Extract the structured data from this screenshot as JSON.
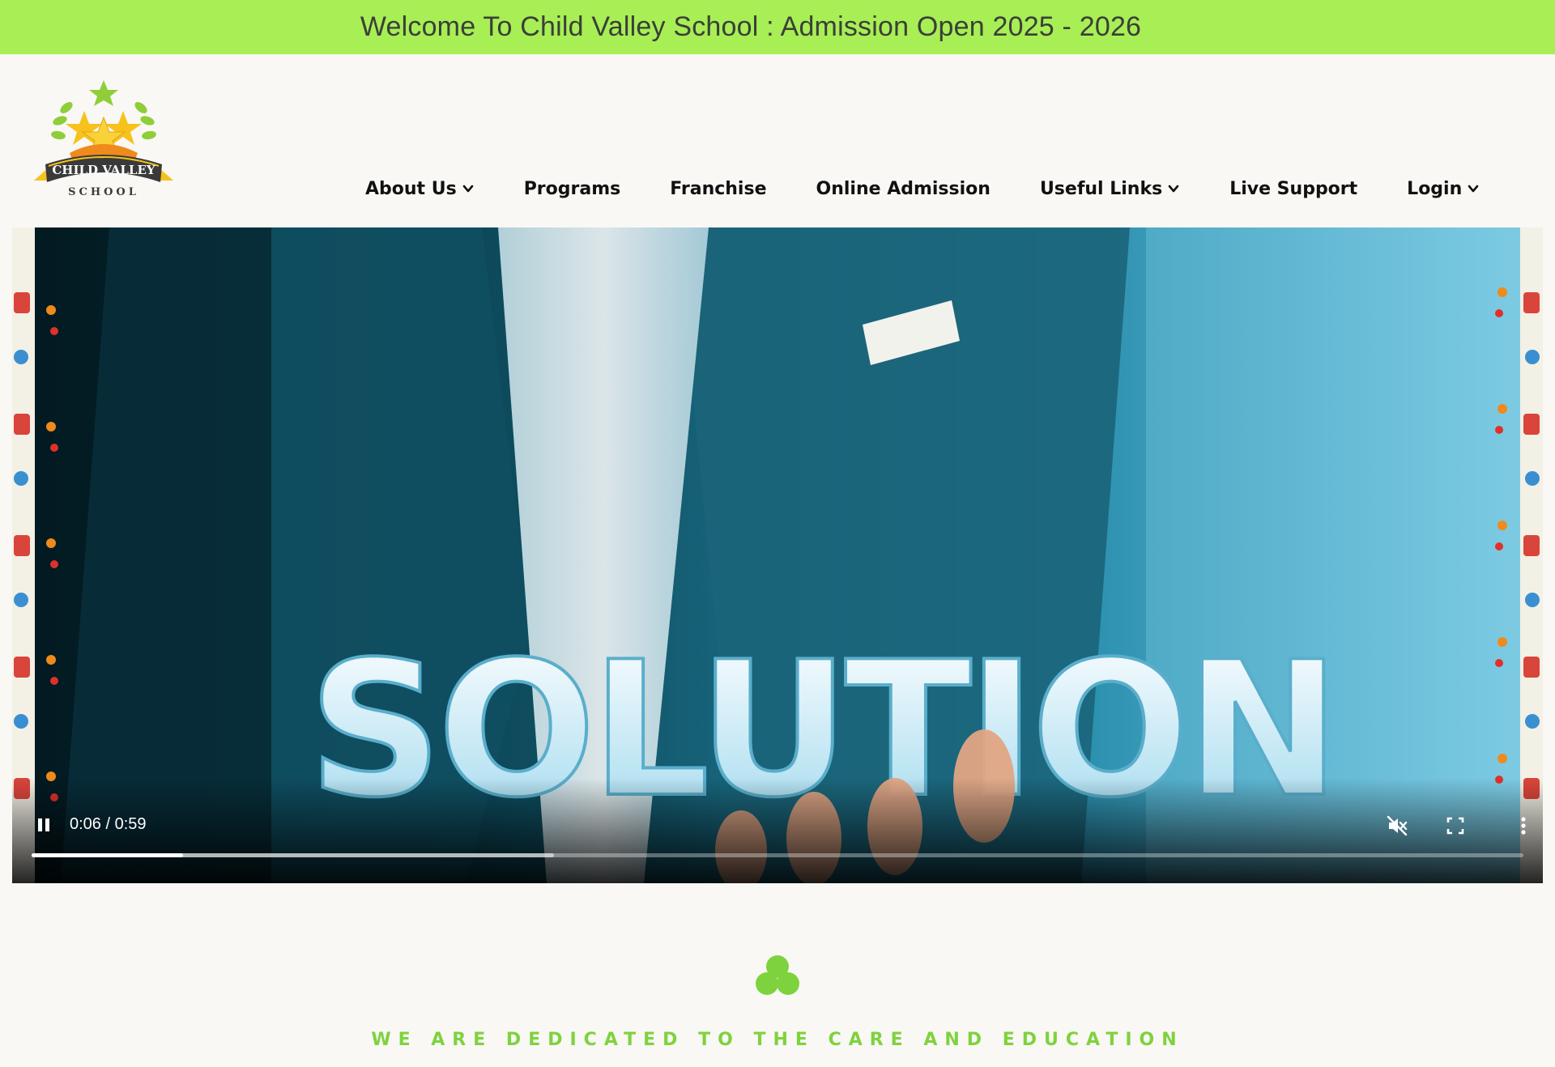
{
  "announcement": "Welcome To Child Valley School : Admission Open 2025 - 2026",
  "logo": {
    "line1": "CHILD VALLEY",
    "line2": "SCHOOL"
  },
  "nav": [
    {
      "label": "About Us",
      "has_dropdown": true
    },
    {
      "label": "Programs",
      "has_dropdown": false
    },
    {
      "label": "Franchise",
      "has_dropdown": false
    },
    {
      "label": "Online Admission",
      "has_dropdown": false
    },
    {
      "label": "Useful Links",
      "has_dropdown": true
    },
    {
      "label": "Live Support",
      "has_dropdown": false
    },
    {
      "label": "Login",
      "has_dropdown": true
    }
  ],
  "video": {
    "overlay_text": "SOLUTION",
    "time_display": "0:06 / 0:59",
    "current_seconds": 6,
    "duration_seconds": 59,
    "buffered_fraction": 0.35,
    "state": "playing",
    "muted": true,
    "icons": [
      "pause-icon",
      "muted-speaker-icon",
      "fullscreen-icon",
      "more-options-icon"
    ]
  },
  "tagline": "WE ARE DEDICATED TO THE CARE AND EDUCATION",
  "colors": {
    "brand_green": "#a8ee55",
    "tagline_green": "#7ed23e",
    "page_bg": "#f9f8f4",
    "clover_green": "#7ed23e"
  }
}
